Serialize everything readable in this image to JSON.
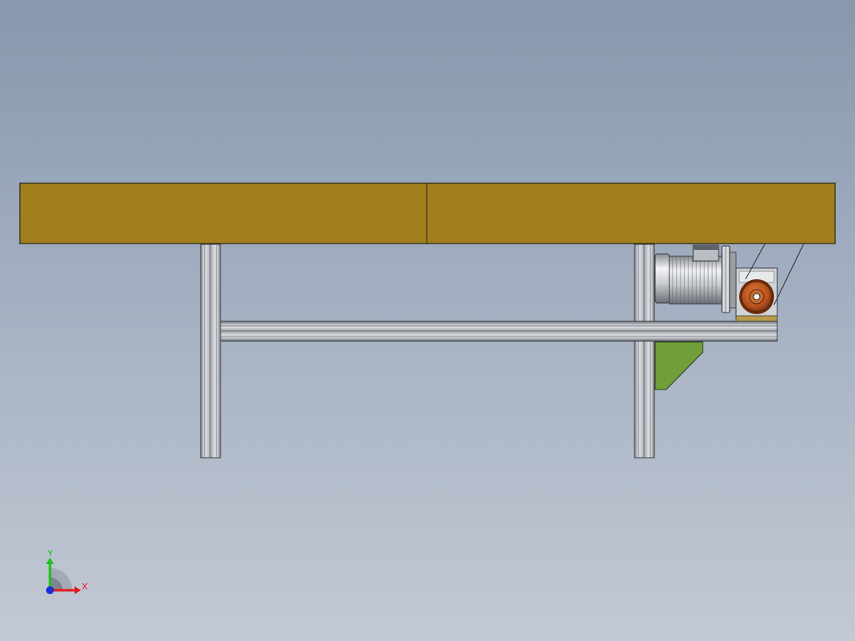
{
  "viewport": {
    "background_top": "#8797ad",
    "background_bottom": "#c3c9d4"
  },
  "model": {
    "belt_color": "#a07f1c",
    "frame_color": "#c8ccd2",
    "bracket_color": "#6f9e3a",
    "sprocket_color": "#b8521e",
    "motor_color": "#d4d6d9"
  },
  "triad": {
    "x_label": "X",
    "y_label": "Y",
    "x_color": "#e21a1a",
    "y_color": "#19c21c",
    "z_color": "#1a2fd6"
  }
}
